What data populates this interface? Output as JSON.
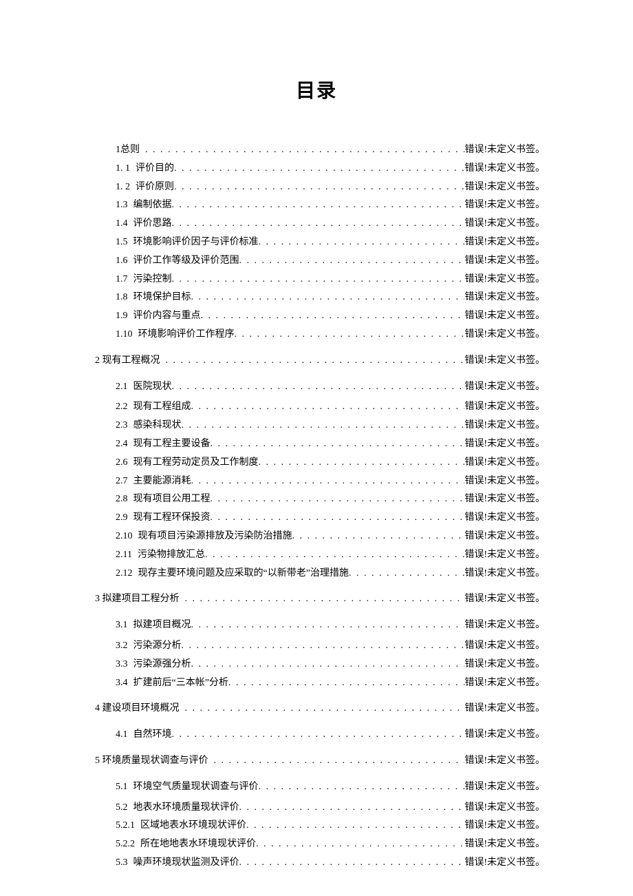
{
  "doc": {
    "title": "目录",
    "error_ref": "错误!未定义书签。",
    "toc": [
      {
        "num": "1总则",
        "label": "",
        "indent": "indent-0",
        "gap": false
      },
      {
        "num": "1. 1",
        "label": "评价目的",
        "indent": "indent-0",
        "gap": false
      },
      {
        "num": "1. 2",
        "label": "评价原则",
        "indent": "indent-0",
        "gap": false
      },
      {
        "num": "1.3",
        "label": "编制依据",
        "indent": "indent-1",
        "gap": false
      },
      {
        "num": "1.4",
        "label": "评价思路",
        "indent": "indent-1",
        "gap": false
      },
      {
        "num": "1.5",
        "label": "环境影响评价因子与评价标准",
        "indent": "indent-1",
        "gap": false
      },
      {
        "num": "1.6",
        "label": "评价工作等级及评价范围",
        "indent": "indent-1",
        "gap": false
      },
      {
        "num": "1.7",
        "label": "污染控制",
        "indent": "indent-1",
        "gap": false
      },
      {
        "num": "1.8",
        "label": "环境保护目标",
        "indent": "indent-1",
        "gap": false
      },
      {
        "num": "1.9",
        "label": "评价内容与重点",
        "indent": "indent-1",
        "gap": false
      },
      {
        "num": "1.10",
        "label": "环境影响评价工作程序",
        "indent": "indent-1",
        "gap": false
      },
      {
        "num": "2 现有工程概况",
        "label": "",
        "indent": "section-head",
        "gap": true
      },
      {
        "num": "2.1",
        "label": "医院现状",
        "indent": "indent-1",
        "gap": true
      },
      {
        "num": "2.2",
        "label": "现有工程组成",
        "indent": "indent-1",
        "gap": false
      },
      {
        "num": "2.3",
        "label": "感染科现状",
        "indent": "indent-1",
        "gap": false
      },
      {
        "num": "2.4",
        "label": "现有工程主要设备",
        "indent": "indent-1",
        "gap": false
      },
      {
        "num": "2.6",
        "label": "现有工程劳动定员及工作制度",
        "indent": "indent-1",
        "gap": false
      },
      {
        "num": "2.7",
        "label": "主要能源消耗",
        "indent": "indent-1",
        "gap": false
      },
      {
        "num": "2.8",
        "label": "现有项目公用工程",
        "indent": "indent-1",
        "gap": false
      },
      {
        "num": "2.9",
        "label": "现有工程环保投资",
        "indent": "indent-1",
        "gap": false
      },
      {
        "num": "2.10",
        "label": "现有项目污染源排放及污染防治措施",
        "indent": "indent-1",
        "gap": false
      },
      {
        "num": "2.11",
        "label": "污染物排放汇总",
        "indent": "indent-1",
        "gap": false
      },
      {
        "num": "2.12",
        "label": "现存主要环境问题及应采取的“以新带老”治理措施",
        "indent": "indent-1",
        "gap": false
      },
      {
        "num": "3 拟建项目工程分析",
        "label": "",
        "indent": "section-head",
        "gap": true
      },
      {
        "num": "3.1",
        "label": "拟建项目概况",
        "indent": "indent-1",
        "gap": true
      },
      {
        "num": "3.2",
        "label": "污染源分析",
        "indent": "indent-1",
        "gap": false
      },
      {
        "num": "3.3",
        "label": "污染源强分析",
        "indent": "indent-1",
        "gap": false
      },
      {
        "num": "3.4",
        "label": "扩建前后“三本帐”分析",
        "indent": "indent-1",
        "gap": false
      },
      {
        "num": "4 建设项目环境概况",
        "label": "",
        "indent": "section-head",
        "gap": true
      },
      {
        "num": "4.1",
        "label": "自然环境",
        "indent": "indent-1",
        "gap": true
      },
      {
        "num": "5 环境质量现状调查与评价",
        "label": "",
        "indent": "section-head",
        "gap": true
      },
      {
        "num": "5.1",
        "label": "环境空气质量现状调查与评价",
        "indent": "indent-1",
        "gap": true
      },
      {
        "num": "5.2",
        "label": "地表水环境质量现状评价",
        "indent": "indent-1",
        "gap": false
      },
      {
        "num": "5.2.1",
        "label": "区域地表水环境现状评价",
        "indent": "indent-1",
        "gap": false
      },
      {
        "num": "5.2.2",
        "label": "所在地地表水环境现状评价",
        "indent": "indent-1",
        "gap": false
      },
      {
        "num": "5.3",
        "label": "噪声环境现状监测及评价",
        "indent": "indent-1",
        "gap": false
      }
    ]
  }
}
